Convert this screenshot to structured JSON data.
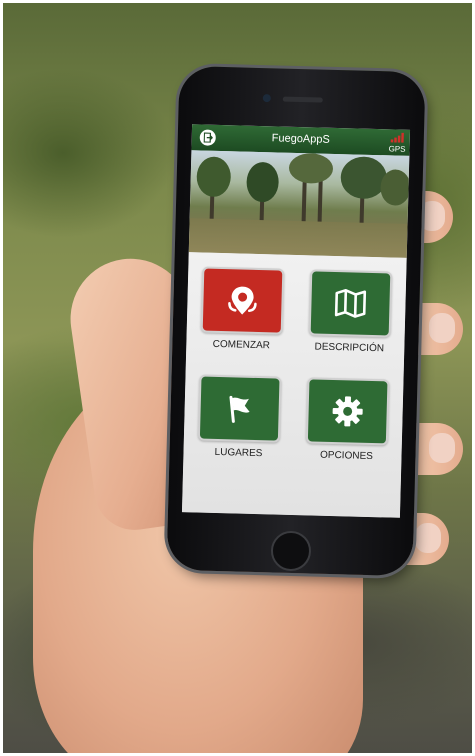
{
  "app": {
    "title": "FuegoAppS",
    "gps_label": "GPS"
  },
  "menu": {
    "items": [
      {
        "label": "COMENZAR",
        "icon": "location-pin-icon",
        "color": "#c42a22"
      },
      {
        "label": "DESCRIPCIÓN",
        "icon": "map-icon",
        "color": "#2e6b34"
      },
      {
        "label": "LUGARES",
        "icon": "flag-icon",
        "color": "#2e6b34"
      },
      {
        "label": "OPCIONES",
        "icon": "gear-icon",
        "color": "#2e6b34"
      }
    ]
  },
  "colors": {
    "appbar": "#1d4b22",
    "gps_signal": "#d0302a",
    "screen_bg": "#e9e9e9"
  }
}
